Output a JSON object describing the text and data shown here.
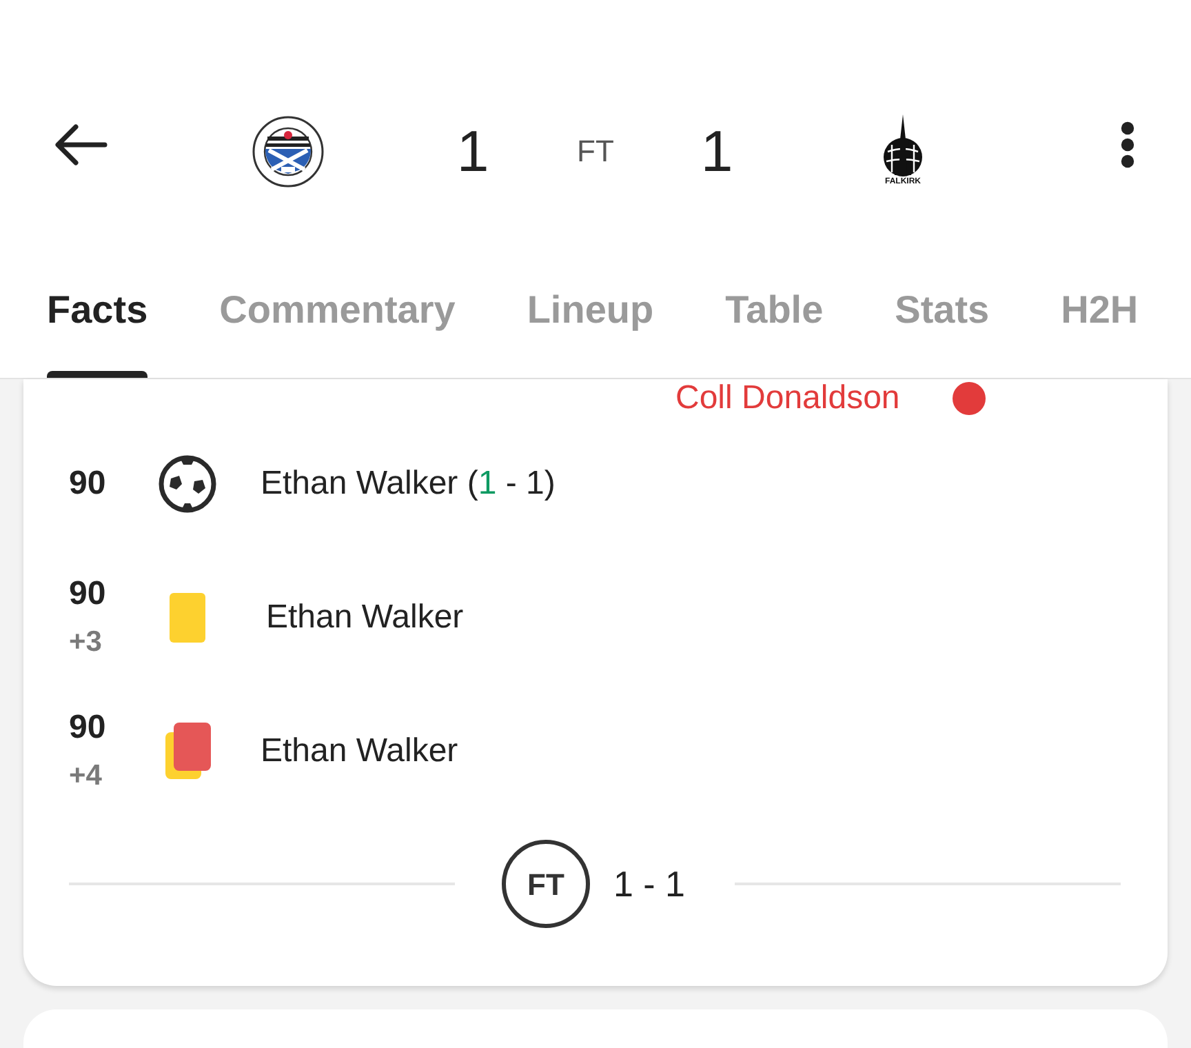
{
  "header": {
    "home_score": "1",
    "status": "FT",
    "away_score": "1",
    "away_crest_label": "FALKIRK"
  },
  "tabs": [
    {
      "label": "Facts",
      "selected": true
    },
    {
      "label": "Commentary",
      "selected": false
    },
    {
      "label": "Lineup",
      "selected": false
    },
    {
      "label": "Table",
      "selected": false
    },
    {
      "label": "Stats",
      "selected": false
    },
    {
      "label": "H2H",
      "selected": false
    }
  ],
  "events": [
    {
      "kind": "cut_off",
      "player": "Coll Donaldson"
    },
    {
      "kind": "goal",
      "minute": "90",
      "player": "Ethan Walker",
      "score": {
        "open": "(",
        "home": "1",
        "separator": " - ",
        "away": "1",
        "close": ")"
      },
      "home_scored": true
    },
    {
      "kind": "yellow_card",
      "minute": "90",
      "added_time": "+3",
      "player": "Ethan Walker"
    },
    {
      "kind": "second_yellow",
      "minute": "90",
      "added_time": "+4",
      "player": "Ethan Walker"
    }
  ],
  "final": {
    "status": "FT",
    "score": "1 - 1"
  }
}
